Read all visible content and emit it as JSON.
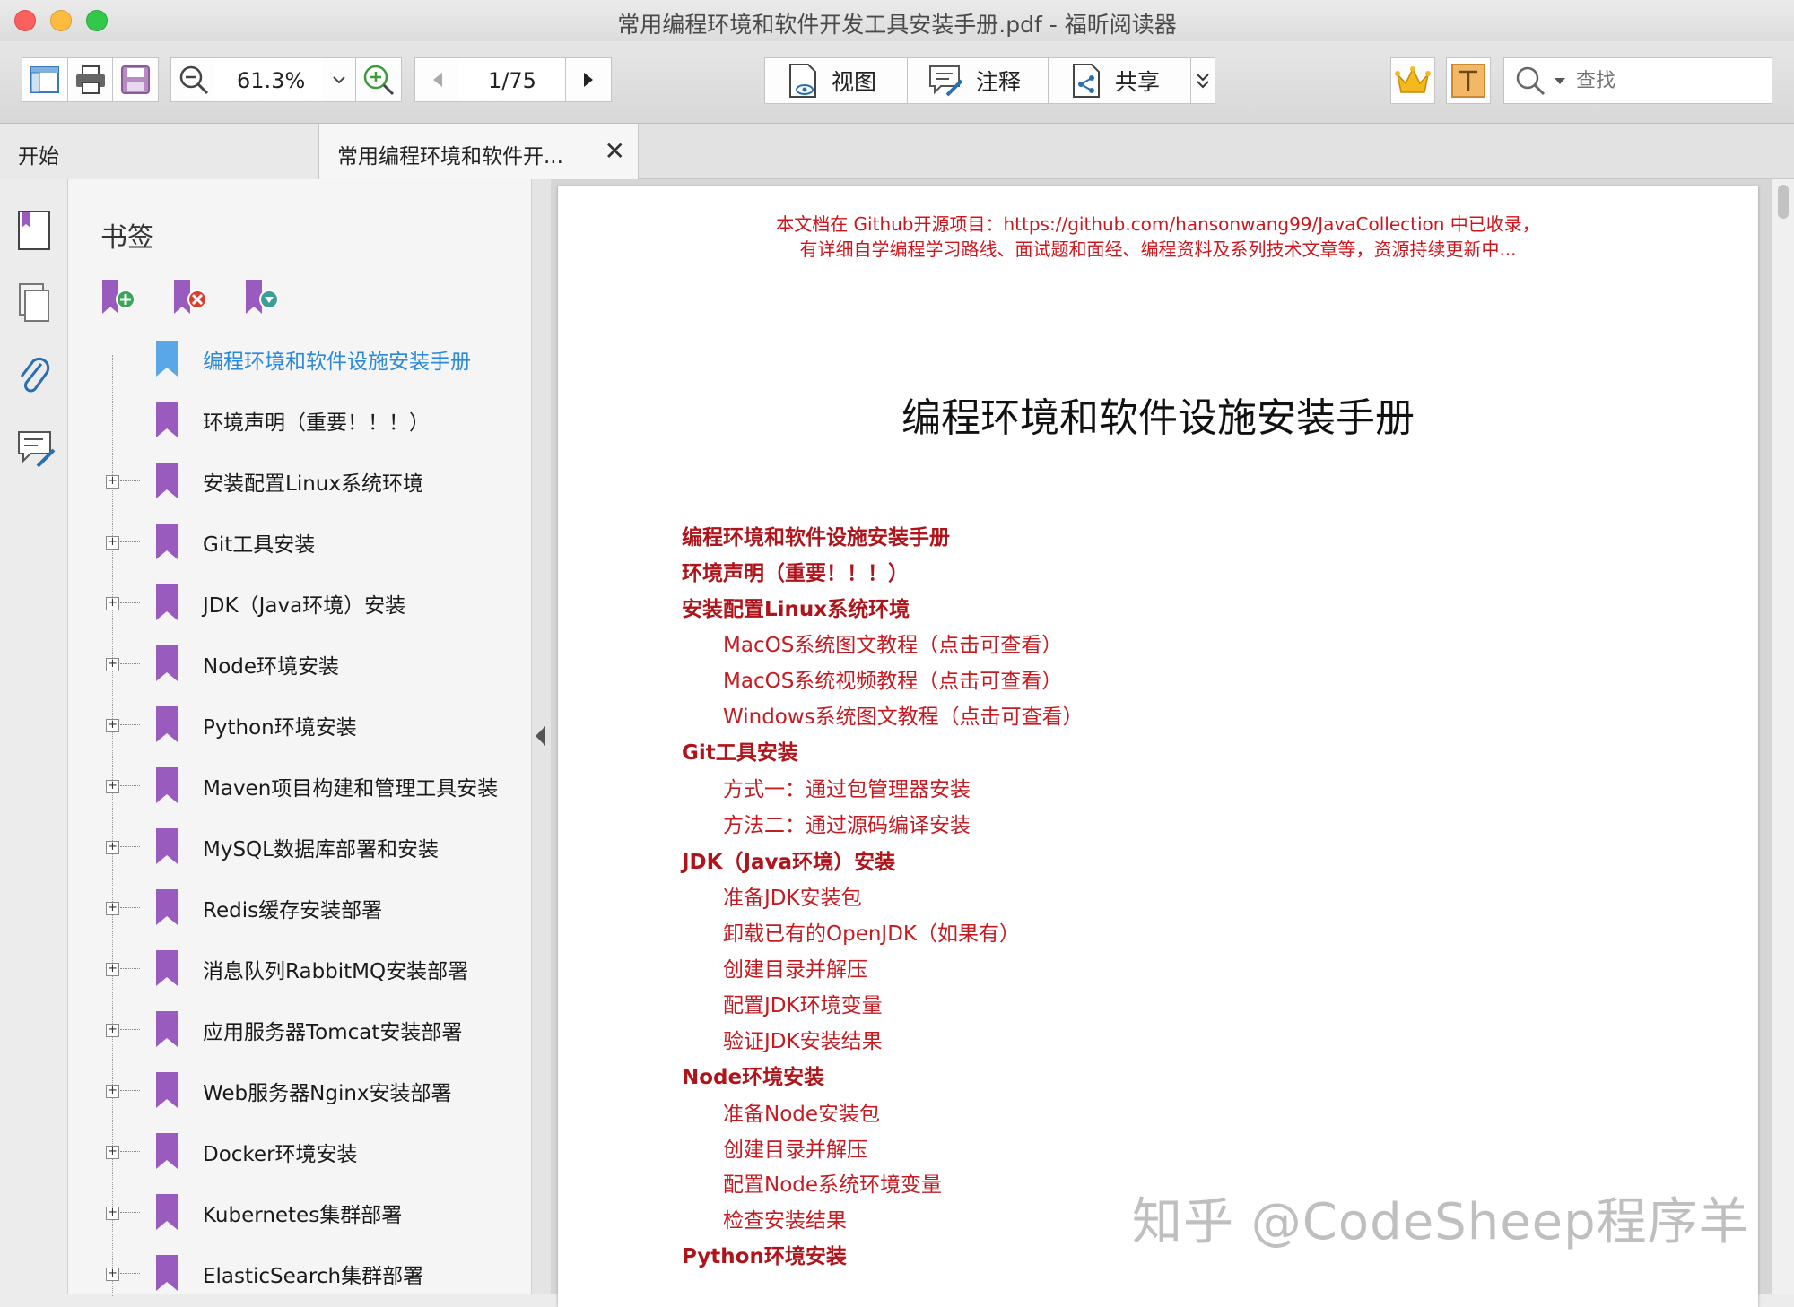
{
  "window": {
    "title": "常用编程环境和软件开发工具安装手册.pdf - 福昕阅读器"
  },
  "toolbar": {
    "zoom": "61.3%",
    "page": "1/75",
    "view_label": "视图",
    "annotate_label": "注释",
    "share_label": "共享",
    "search_placeholder": "查找"
  },
  "tabs": {
    "start": "开始",
    "document": "常用编程环境和软件开..."
  },
  "bookmarks": {
    "title": "书签",
    "items": [
      {
        "label": "编程环境和软件设施安装手册"
      },
      {
        "label": "环境声明（重要！！！）"
      },
      {
        "label": "安装配置Linux系统环境"
      },
      {
        "label": "Git工具安装"
      },
      {
        "label": "JDK（Java环境）安装"
      },
      {
        "label": "Node环境安装"
      },
      {
        "label": "Python环境安装"
      },
      {
        "label": "Maven项目构建和管理工具安装"
      },
      {
        "label": "MySQL数据库部署和安装"
      },
      {
        "label": "Redis缓存安装部署"
      },
      {
        "label": "消息队列RabbitMQ安装部署"
      },
      {
        "label": "应用服务器Tomcat安装部署"
      },
      {
        "label": "Web服务器Nginx安装部署"
      },
      {
        "label": "Docker环境安装"
      },
      {
        "label": "Kubernetes集群部署"
      },
      {
        "label": "ElasticSearch集群部署"
      }
    ]
  },
  "document": {
    "header_line1": "本文档在 Github开源项目：https://github.com/hansonwang99/JavaCollection 中已收录，",
    "header_line2": "有详细自学编程学习路线、面试题和面经、编程资料及系列技术文章等，资源持续更新中...",
    "title": "编程环境和软件设施安装手册",
    "toc": [
      {
        "text": "编程环境和软件设施安装手册",
        "level": 1
      },
      {
        "text": "环境声明（重要！！！）",
        "level": 1
      },
      {
        "text": "安装配置Linux系统环境",
        "level": 1
      },
      {
        "text": "MacOS系统图文教程（点击可查看）",
        "level": 2
      },
      {
        "text": "MacOS系统视频教程（点击可查看）",
        "level": 2
      },
      {
        "text": "Windows系统图文教程（点击可查看）",
        "level": 2
      },
      {
        "text": "Git工具安装",
        "level": 1
      },
      {
        "text": "方式一：通过包管理器安装",
        "level": 2
      },
      {
        "text": "方法二：通过源码编译安装",
        "level": 2
      },
      {
        "text": "JDK（Java环境）安装",
        "level": 1
      },
      {
        "text": "准备JDK安装包",
        "level": 2
      },
      {
        "text": "卸载已有的OpenJDK（如果有）",
        "level": 2
      },
      {
        "text": "创建目录并解压",
        "level": 2
      },
      {
        "text": "配置JDK环境变量",
        "level": 2
      },
      {
        "text": "验证JDK安装结果",
        "level": 2
      },
      {
        "text": "Node环境安装",
        "level": 1
      },
      {
        "text": "准备Node安装包",
        "level": 2
      },
      {
        "text": "创建目录并解压",
        "level": 2
      },
      {
        "text": "配置Node系统环境变量",
        "level": 2
      },
      {
        "text": "检查安装结果",
        "level": 2
      },
      {
        "text": "Python环境安装",
        "level": 1
      }
    ]
  },
  "watermark": "知乎 @CodeSheep程序羊",
  "colors": {
    "bookmark_purple": "#9a5bbf",
    "bookmark_active": "#5aa7e8",
    "toc_red": "#c51b22"
  }
}
